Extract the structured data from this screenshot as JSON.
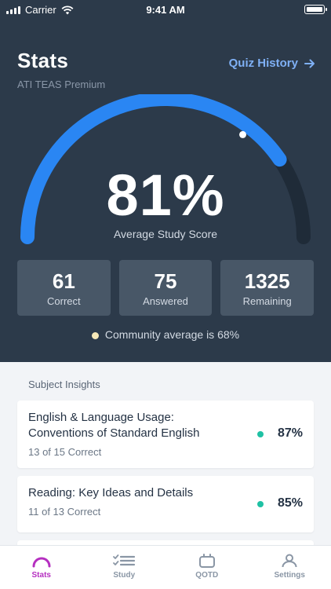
{
  "status": {
    "carrier": "Carrier",
    "time": "9:41 AM"
  },
  "header": {
    "title": "Stats",
    "subtitle": "ATI TEAS Premium",
    "quiz_history": "Quiz History"
  },
  "gauge": {
    "score_text": "81%",
    "score_value": 0.81,
    "label": "Average Study Score"
  },
  "cards": [
    {
      "value": "61",
      "label": "Correct"
    },
    {
      "value": "75",
      "label": "Answered"
    },
    {
      "value": "1325",
      "label": "Remaining"
    }
  ],
  "community": "Community average is 68%",
  "insights": {
    "title": "Subject Insights",
    "items": [
      {
        "name": "English & Language Usage: Conventions of Standard English",
        "sub": "13 of 15 Correct",
        "pct": "87%"
      },
      {
        "name": "Reading: Key Ideas and Details",
        "sub": "11 of 13 Correct",
        "pct": "85%"
      }
    ]
  },
  "tabs": [
    {
      "label": "Stats",
      "icon": "stats-gauge-icon"
    },
    {
      "label": "Study",
      "icon": "checklist-icon"
    },
    {
      "label": "QOTD",
      "icon": "calendar-tv-icon"
    },
    {
      "label": "Settings",
      "icon": "person-icon"
    }
  ],
  "colors": {
    "header_bg": "#2c3a4a",
    "gauge_fill": "#2a86f3",
    "accent_text": "#7fb0f5",
    "active_tab": "#b52fc0",
    "dot_green": "#1fc1a4"
  }
}
